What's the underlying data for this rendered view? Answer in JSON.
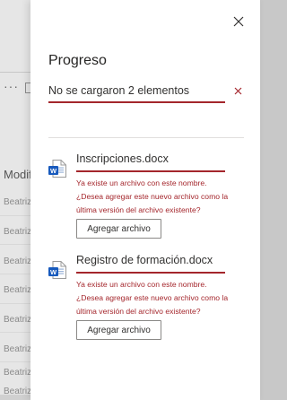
{
  "background": {
    "column_header": "Modifi",
    "rows": [
      "Beatriz C",
      "Beatriz C",
      "Beatriz C",
      "Beatriz C",
      "Beatriz C",
      "Beatriz C",
      "Beatriz C",
      "Beatriz C"
    ]
  },
  "panel": {
    "title": "Progreso",
    "summary": "No se cargaron 2 elementos",
    "colors": {
      "error": "#a4262c",
      "word": "#185abd"
    },
    "files": [
      {
        "name": "Inscripciones.docx",
        "error": "Ya existe un archivo con este nombre. ¿Desea agregar este nuevo archivo como la última versión del archivo existente?",
        "button_label": "Agregar archivo"
      },
      {
        "name": "Registro de formación.docx",
        "error": "Ya existe un archivo con este nombre. ¿Desea agregar este nuevo archivo como la última versión del archivo existente?",
        "button_label": "Agregar archivo"
      }
    ]
  }
}
